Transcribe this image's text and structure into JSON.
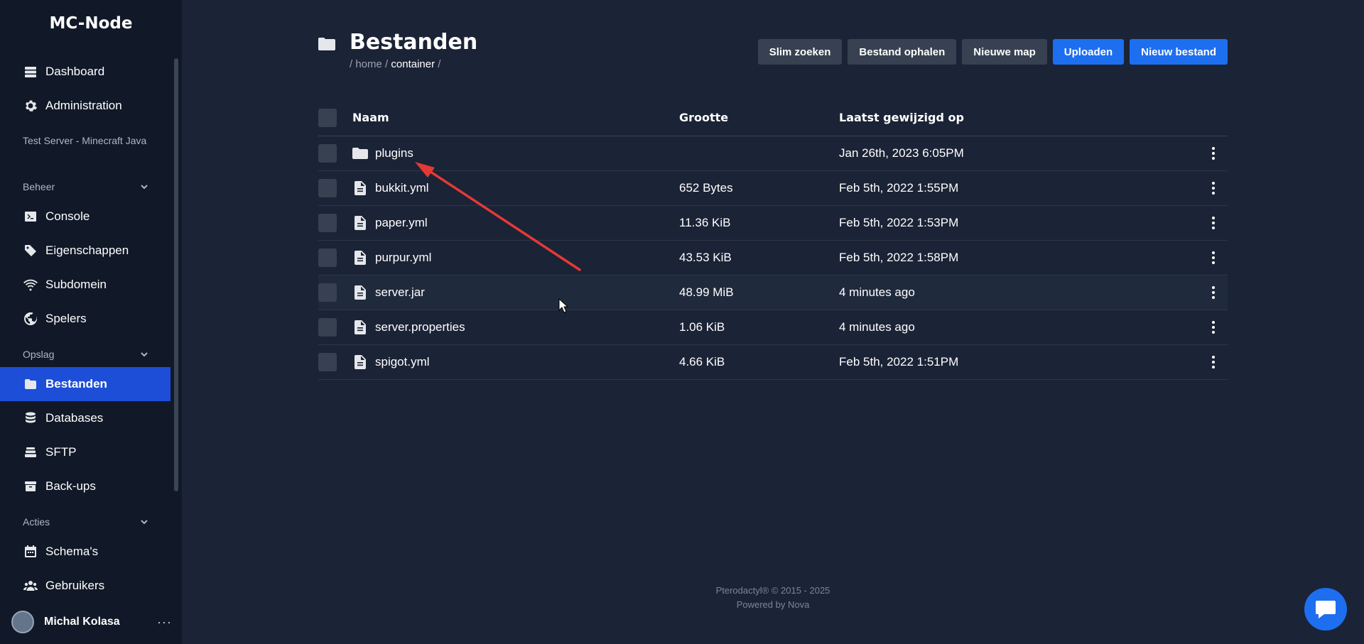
{
  "sidebar": {
    "brand": "MC-Node",
    "top_items": [
      {
        "label": "Dashboard",
        "icon": "server-stack-icon"
      },
      {
        "label": "Administration",
        "icon": "gear-icon"
      }
    ],
    "server_name": "Test Server - Minecraft Java",
    "sections": [
      {
        "title": "Beheer",
        "items": [
          {
            "label": "Console",
            "icon": "terminal-icon"
          },
          {
            "label": "Eigenschappen",
            "icon": "tag-icon"
          },
          {
            "label": "Subdomein",
            "icon": "wifi-icon"
          },
          {
            "label": "Spelers",
            "icon": "globe-icon"
          }
        ]
      },
      {
        "title": "Opslag",
        "items": [
          {
            "label": "Bestanden",
            "icon": "folder-icon",
            "active": true
          },
          {
            "label": "Databases",
            "icon": "database-icon"
          },
          {
            "label": "SFTP",
            "icon": "layers-icon"
          },
          {
            "label": "Back-ups",
            "icon": "archive-icon"
          }
        ]
      },
      {
        "title": "Acties",
        "items": [
          {
            "label": "Schema's",
            "icon": "calendar-icon"
          },
          {
            "label": "Gebruikers",
            "icon": "users-icon"
          }
        ]
      }
    ],
    "user": {
      "name": "Michal Kolasa",
      "more": "···"
    }
  },
  "header": {
    "title": "Bestanden",
    "breadcrumb": {
      "sep": "/",
      "parts": [
        "home",
        "container"
      ]
    },
    "actions": [
      {
        "label": "Slim zoeken",
        "primary": false
      },
      {
        "label": "Bestand ophalen",
        "primary": false
      },
      {
        "label": "Nieuwe map",
        "primary": false
      },
      {
        "label": "Uploaden",
        "primary": true
      },
      {
        "label": "Nieuw bestand",
        "primary": true
      }
    ]
  },
  "table": {
    "columns": {
      "name": "Naam",
      "size": "Grootte",
      "modified": "Laatst gewijzigd op"
    },
    "rows": [
      {
        "name": "plugins",
        "type": "folder",
        "size": "",
        "modified": "Jan 26th, 2023 6:05PM"
      },
      {
        "name": "bukkit.yml",
        "type": "file",
        "size": "652 Bytes",
        "modified": "Feb 5th, 2022 1:55PM"
      },
      {
        "name": "paper.yml",
        "type": "file",
        "size": "11.36 KiB",
        "modified": "Feb 5th, 2022 1:53PM"
      },
      {
        "name": "purpur.yml",
        "type": "file",
        "size": "43.53 KiB",
        "modified": "Feb 5th, 2022 1:58PM"
      },
      {
        "name": "server.jar",
        "type": "file",
        "size": "48.99 MiB",
        "modified": "4 minutes ago",
        "hover": true
      },
      {
        "name": "server.properties",
        "type": "file",
        "size": "1.06 KiB",
        "modified": "4 minutes ago"
      },
      {
        "name": "spigot.yml",
        "type": "file",
        "size": "4.66 KiB",
        "modified": "Feb 5th, 2022 1:51PM"
      }
    ]
  },
  "footer": {
    "line1": "Pterodactyl® © 2015 - 2025",
    "line2": "Powered by Nova"
  },
  "colors": {
    "accent": "#1d6ff0",
    "active_nav": "#1d4ed8",
    "background": "#1b2336",
    "sidebar": "#111827",
    "annotation": "#e53935"
  }
}
